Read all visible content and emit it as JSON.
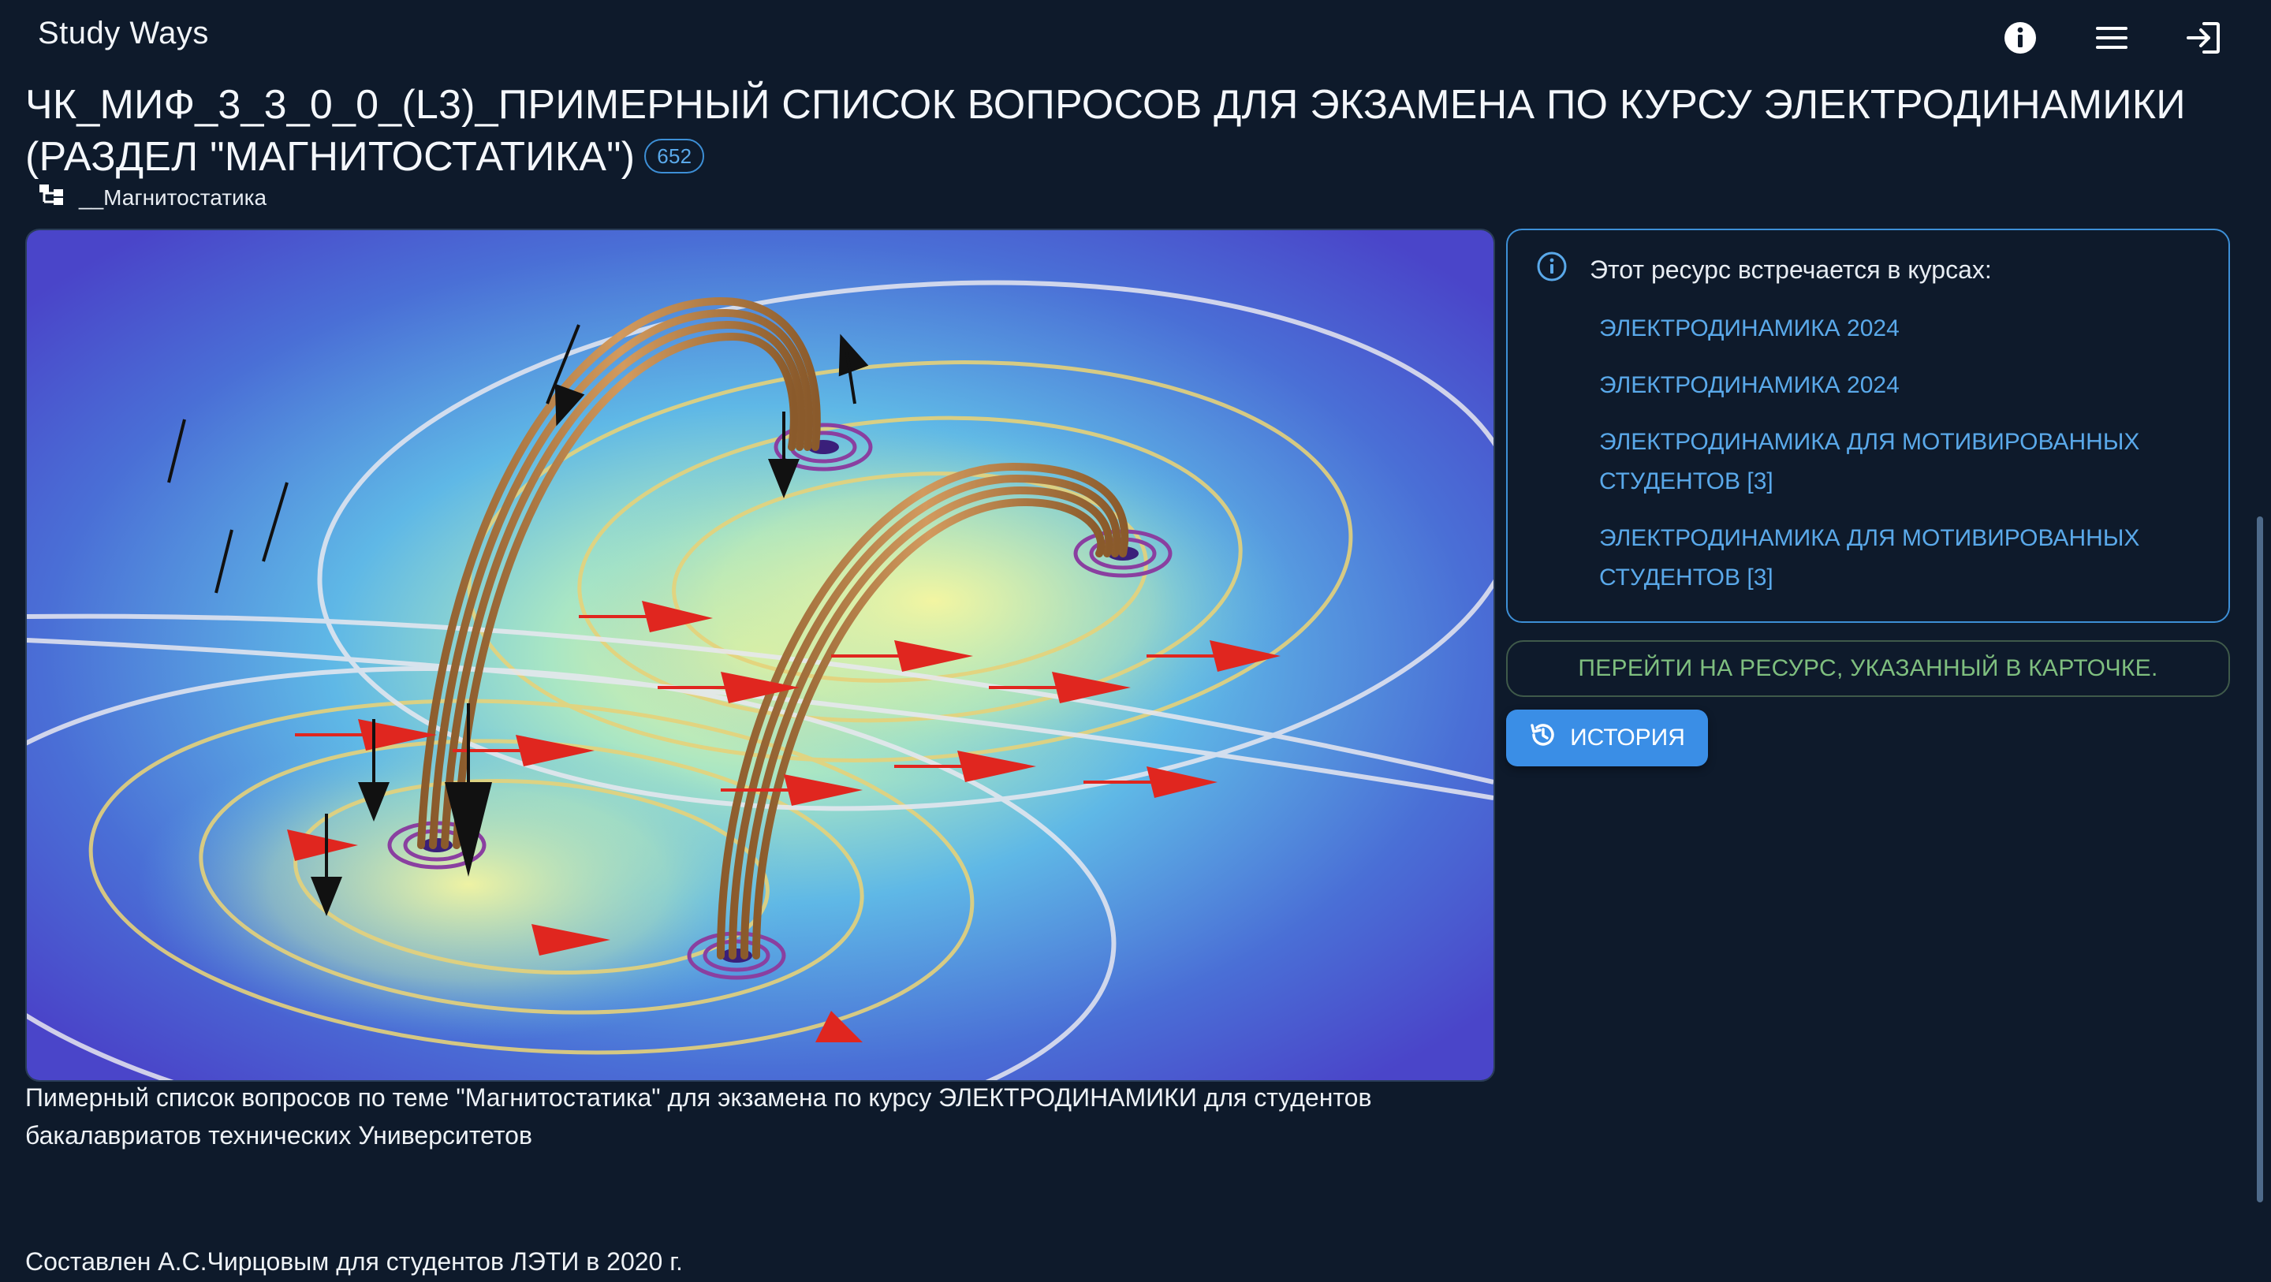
{
  "app": {
    "brand": "Study Ways"
  },
  "header": {
    "info_icon": "info-icon",
    "menu_icon": "menu-icon",
    "login_icon": "login-icon"
  },
  "resource": {
    "title": "ЧК_МИФ_3_3_0_0_(L3)_ПРИМЕРНЫЙ СПИСОК ВОПРОСОВ ДЛЯ ЭКЗАМЕНА ПО КУРСУ ЭЛЕКТРОДИНАМИКИ (РАЗДЕЛ \"МАГНИТОСТАТИКА\")",
    "badge": "652",
    "breadcrumb": "__Магнитостатика",
    "description": "Пимерный список вопросов по теме \"Магнитостатика\" для экзамена по курсу ЭЛЕКТРОДИНАМИКИ для студентов бакалавриатов технических Университетов",
    "author": "Составлен А.С.Чирцовым для студентов ЛЭТИ в 2020 г."
  },
  "courses": {
    "heading": "Этот ресурс встречается в курсах:",
    "items": [
      {
        "label": "ЭЛЕКТРОДИНАМИКА 2024"
      },
      {
        "label": "ЭЛЕКТРОДИНАМИКА 2024"
      },
      {
        "label": "ЭЛЕКТРОДИНАМИКА ДЛЯ МОТИВИРОВАННЫХ СТУДЕНТОВ [3]"
      },
      {
        "label": "ЭЛЕКТРОДИНАМИКА ДЛЯ МОТИВИРОВАННЫХ СТУДЕНТОВ [3]"
      }
    ]
  },
  "actions": {
    "goto_label": "ПЕРЕЙТИ НА РЕСУРС, УКАЗАННЫЙ В КАРТОЧКЕ.",
    "history_label": "ИСТОРИЯ"
  },
  "colors": {
    "background": "#0e1a2b",
    "accent": "#3a8ee6",
    "link": "#5aa9ea",
    "goto_text": "#7fbf7f"
  }
}
